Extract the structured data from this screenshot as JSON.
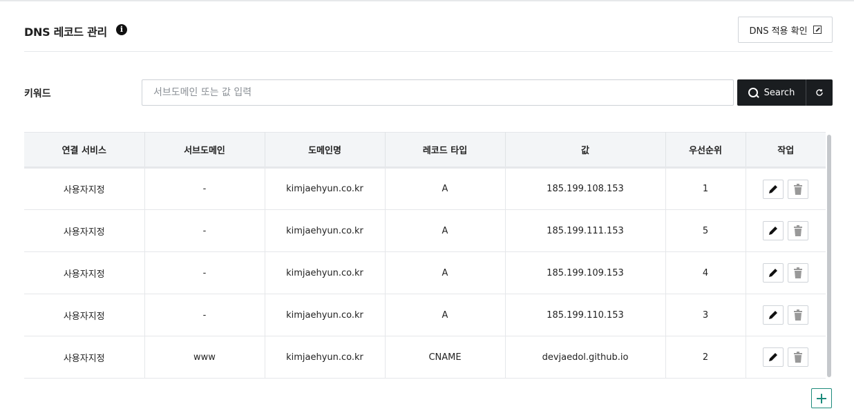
{
  "header": {
    "title": "DNS 레코드 관리",
    "info_icon": "info-icon",
    "dns_check_label": "DNS 적용 확인",
    "dns_check_icon": "external-link-icon"
  },
  "search": {
    "label": "키워드",
    "placeholder": "서브도메인 또는 값 입력",
    "value": "",
    "button_label": "Search",
    "search_icon": "search-icon",
    "refresh_icon": "refresh-icon"
  },
  "table": {
    "columns": [
      "연결 서비스",
      "서브도메인",
      "도메인명",
      "레코드 타입",
      "값",
      "우선순위",
      "작업"
    ],
    "rows": [
      {
        "service": "사용자지정",
        "subdomain": "-",
        "domain": "kimjaehyun.co.kr",
        "type": "A",
        "value": "185.199.108.153",
        "priority": "1"
      },
      {
        "service": "사용자지정",
        "subdomain": "-",
        "domain": "kimjaehyun.co.kr",
        "type": "A",
        "value": "185.199.111.153",
        "priority": "5"
      },
      {
        "service": "사용자지정",
        "subdomain": "-",
        "domain": "kimjaehyun.co.kr",
        "type": "A",
        "value": "185.199.109.153",
        "priority": "4"
      },
      {
        "service": "사용자지정",
        "subdomain": "-",
        "domain": "kimjaehyun.co.kr",
        "type": "A",
        "value": "185.199.110.153",
        "priority": "3"
      },
      {
        "service": "사용자지정",
        "subdomain": "www",
        "domain": "kimjaehyun.co.kr",
        "type": "CNAME",
        "value": "devjaedol.github.io",
        "priority": "2"
      }
    ],
    "row_actions": {
      "edit_icon": "pencil-icon",
      "delete_icon": "trash-icon"
    }
  },
  "add_button": {
    "icon": "plus-icon"
  },
  "colors": {
    "primary_dark": "#1a1d20",
    "accent_teal": "#1c8a7b",
    "header_bg": "#f3f5f7"
  }
}
